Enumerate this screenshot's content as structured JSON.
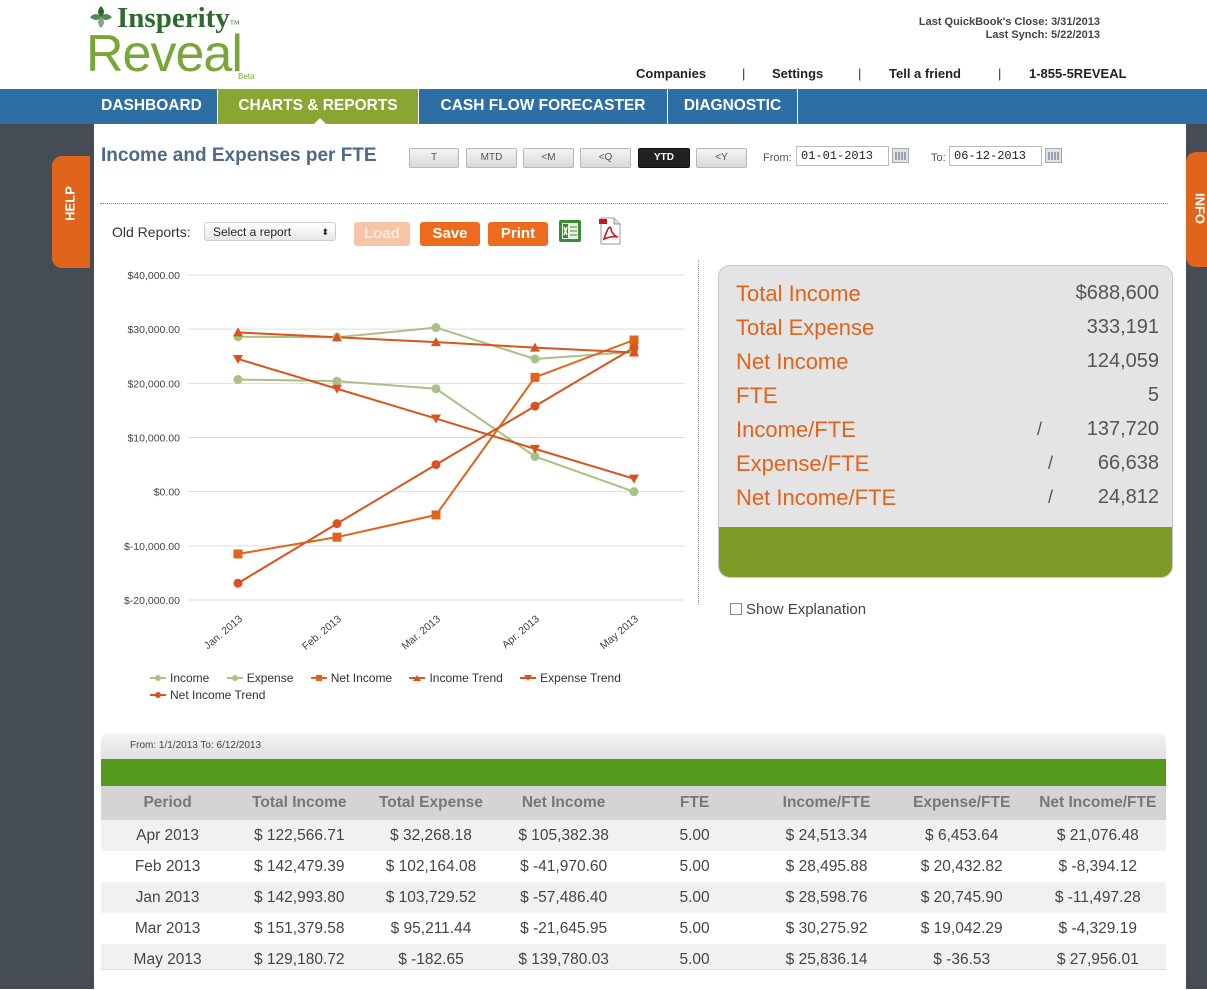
{
  "header": {
    "brand": "Insperity",
    "brand_tm": "™",
    "product": "Reveal",
    "product_tm": "™",
    "beta": "Beta",
    "last_close": "Last QuickBook's Close: 3/31/2013",
    "last_synch": "Last Synch: 5/22/2013",
    "links": [
      "Companies",
      "Settings",
      "Tell a friend",
      "1-855-5REVEAL"
    ],
    "separator": "|"
  },
  "nav": {
    "tabs": [
      "DASHBOARD",
      "CHARTS & REPORTS",
      "CASH FLOW FORECASTER",
      "DIAGNOSTIC"
    ],
    "active": "CHARTS & REPORTS"
  },
  "side_tabs": {
    "help": "HELP",
    "info": "INFO"
  },
  "page": {
    "title": "Income and Expenses per FTE",
    "period_buttons": [
      "T",
      "MTD",
      "<M",
      "<Q",
      "YTD",
      "<Y"
    ],
    "active_period": "YTD",
    "from_label": "From:",
    "from_value": "01-01-2013",
    "to_label": "To:",
    "to_value": "06-12-2013"
  },
  "reports": {
    "old_reports_label": "Old Reports:",
    "select_value": "Select a report",
    "select_arrows": "⬍",
    "load": "Load",
    "save": "Save",
    "print": "Print"
  },
  "chart_data": {
    "type": "line",
    "categories": [
      "Jan. 2013",
      "Feb. 2013",
      "Mar. 2013",
      "Apr. 2013",
      "May 2013"
    ],
    "y_ticks": [
      "$40,000.00",
      "$30,000.00",
      "$20,000.00",
      "$10,000.00",
      "$0.00",
      "$-10,000.00",
      "$-20,000.00"
    ],
    "ylim": [
      -20000,
      40000
    ],
    "grid": true,
    "legend_position": "bottom",
    "series": [
      {
        "name": "Income",
        "color": "#a9c283",
        "marker": "circle",
        "values": [
          28600,
          28500,
          30300,
          24500,
          25800
        ]
      },
      {
        "name": "Expense",
        "color": "#a9c283",
        "marker": "circle",
        "values": [
          20700,
          20400,
          19000,
          6500,
          0
        ]
      },
      {
        "name": "Net Income",
        "color": "#e0641c",
        "marker": "square",
        "values": [
          -11500,
          -8400,
          -4300,
          21100,
          28000
        ]
      },
      {
        "name": "Income Trend",
        "color": "#d9531e",
        "marker": "triangle-up",
        "values": [
          29400,
          28500,
          27600,
          26600,
          25700
        ]
      },
      {
        "name": "Expense Trend",
        "color": "#d9531e",
        "marker": "triangle-down",
        "values": [
          24500,
          19000,
          13500,
          7900,
          2400
        ]
      },
      {
        "name": "Net Income Trend",
        "color": "#d9531e",
        "marker": "circle",
        "values": [
          -16900,
          -5900,
          5000,
          15800,
          26600
        ]
      }
    ]
  },
  "summary": {
    "rows": [
      {
        "label": "Total Income",
        "slash": "",
        "value": "$688,600"
      },
      {
        "label": "Total Expense",
        "slash": "",
        "value": "333,191"
      },
      {
        "label": "Net Income",
        "slash": "",
        "value": "124,059"
      },
      {
        "label": "FTE",
        "slash": "",
        "value": "5"
      },
      {
        "label": "Income/FTE",
        "slash": "/",
        "value": "137,720"
      },
      {
        "label": "Expense/FTE",
        "slash": "/",
        "value": "66,638"
      },
      {
        "label": "Net Income/FTE",
        "slash": "/",
        "value": "24,812"
      }
    ],
    "show_explanation": "Show Explanation"
  },
  "table": {
    "range": "From: 1/1/2013 To: 6/12/2013",
    "columns": [
      "Period",
      "Total Income",
      "Total Expense",
      "Net Income",
      "FTE",
      "Income/FTE",
      "Expense/FTE",
      "Net Income/FTE"
    ],
    "rows": [
      [
        "Apr 2013",
        "$ 122,566.71",
        "$ 32,268.18",
        "$ 105,382.38",
        "5.00",
        "$ 24,513.34",
        "$ 6,453.64",
        "$ 21,076.48"
      ],
      [
        "Feb 2013",
        "$ 142,479.39",
        "$ 102,164.08",
        "$ -41,970.60",
        "5.00",
        "$ 28,495.88",
        "$ 20,432.82",
        "$ -8,394.12"
      ],
      [
        "Jan 2013",
        "$ 142,993.80",
        "$ 103,729.52",
        "$ -57,486.40",
        "5.00",
        "$ 28,598.76",
        "$ 20,745.90",
        "$ -11,497.28"
      ],
      [
        "Mar 2013",
        "$ 151,379.58",
        "$ 95,211.44",
        "$ -21,645.95",
        "5.00",
        "$ 30,275.92",
        "$ 19,042.29",
        "$ -4,329.19"
      ],
      [
        "May 2013",
        "$ 129,180.72",
        "$ -182.65",
        "$ 139,780.03",
        "5.00",
        "$ 25,836.14",
        "$ -36.53",
        "$ 27,956.01"
      ]
    ]
  }
}
